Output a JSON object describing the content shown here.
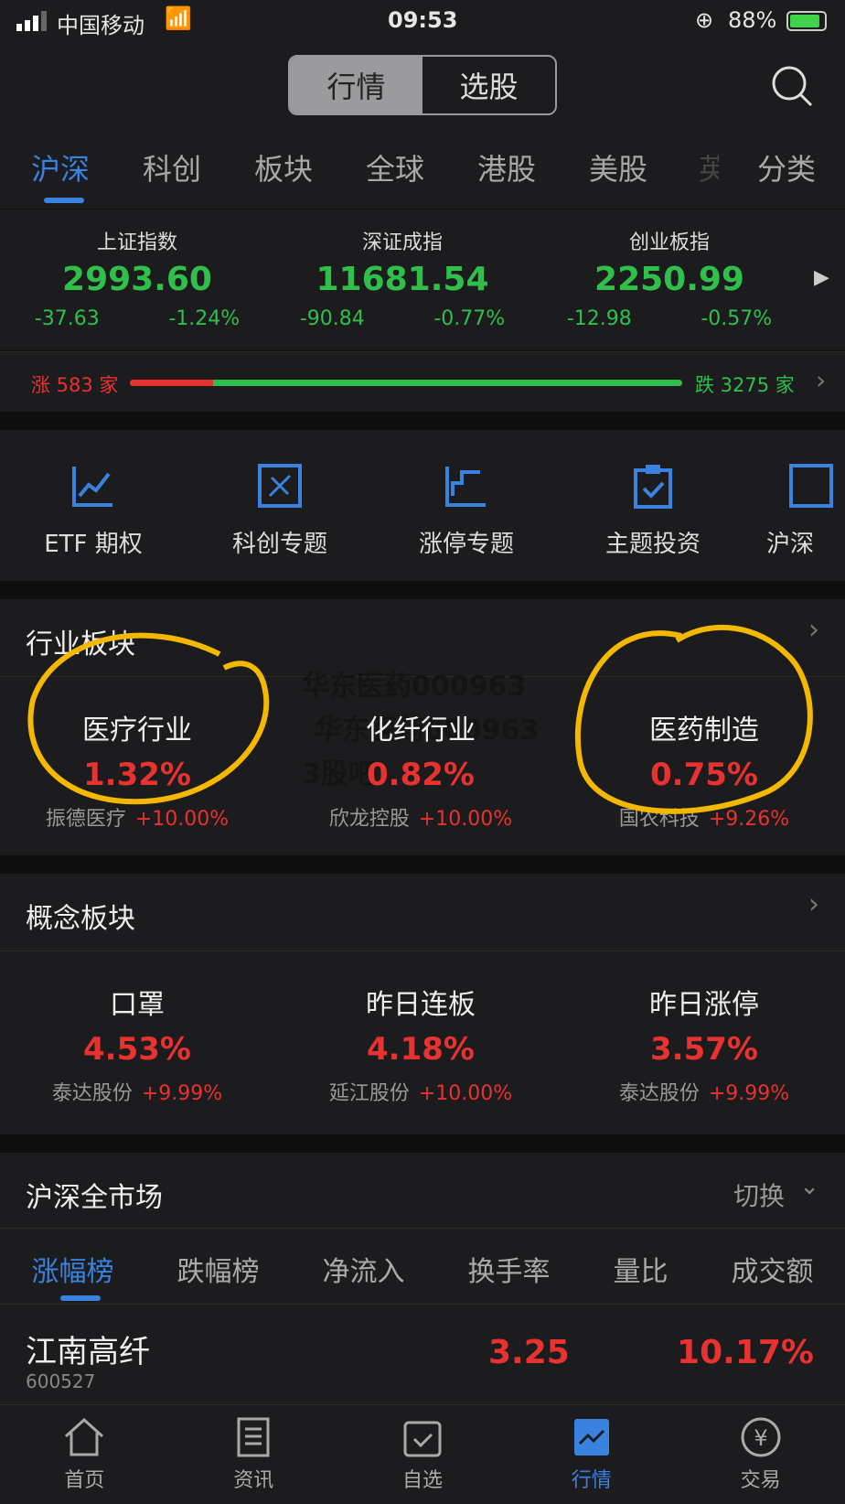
{
  "status": {
    "carrier": "中国移动",
    "time": "09:53",
    "battery": "88%"
  },
  "segment": {
    "active": "行情",
    "other": "选股"
  },
  "tabs": [
    "沪深",
    "科创",
    "板块",
    "全球",
    "港股",
    "美股",
    "英",
    "分类"
  ],
  "indices": [
    {
      "name": "上证指数",
      "value": "2993.60",
      "change": "-37.63",
      "pct": "-1.24%"
    },
    {
      "name": "深证成指",
      "value": "11681.54",
      "change": "-90.84",
      "pct": "-0.77%"
    },
    {
      "name": "创业板指",
      "value": "2250.99",
      "change": "-12.98",
      "pct": "-0.57%"
    }
  ],
  "breadth": {
    "up": "涨 583 家",
    "down": "跌 3275 家",
    "up_fraction": 0.151
  },
  "shortcuts": [
    "ETF 期权",
    "科创专题",
    "涨停专题",
    "主题投资",
    "沪深"
  ],
  "industry": {
    "title": "行业板块",
    "cards": [
      {
        "name": "医疗行业",
        "pct": "1.32%",
        "stock": "振德医疗",
        "stock_pct": "+10.00%"
      },
      {
        "name": "化纤行业",
        "pct": "0.82%",
        "stock": "欣龙控股",
        "stock_pct": "+10.00%"
      },
      {
        "name": "医药制造",
        "pct": "0.75%",
        "stock": "国农科技",
        "stock_pct": "+9.26%"
      }
    ]
  },
  "watermark": [
    "华东医药000963",
    "华东医药000963",
    "3股吧"
  ],
  "concept": {
    "title": "概念板块",
    "cards": [
      {
        "name": "口罩",
        "pct": "4.53%",
        "stock": "泰达股份",
        "stock_pct": "+9.99%"
      },
      {
        "name": "昨日连板",
        "pct": "4.18%",
        "stock": "延江股份",
        "stock_pct": "+10.00%"
      },
      {
        "name": "昨日涨停",
        "pct": "3.57%",
        "stock": "泰达股份",
        "stock_pct": "+9.99%"
      }
    ]
  },
  "market": {
    "title": "沪深全市场",
    "switch": "切换",
    "tabs": [
      "涨幅榜",
      "跌幅榜",
      "净流入",
      "换手率",
      "量比",
      "成交额"
    ],
    "rows": [
      {
        "name": "江南高纤",
        "code": "600527",
        "price": "3.25",
        "pct": "10.17%"
      }
    ]
  },
  "bottom_nav": [
    "首页",
    "资讯",
    "自选",
    "行情",
    "交易"
  ],
  "colors": {
    "accent": "#3a82e0",
    "up": "#e8322f",
    "down": "#2fbf4a",
    "highlight": "#f5b800"
  }
}
